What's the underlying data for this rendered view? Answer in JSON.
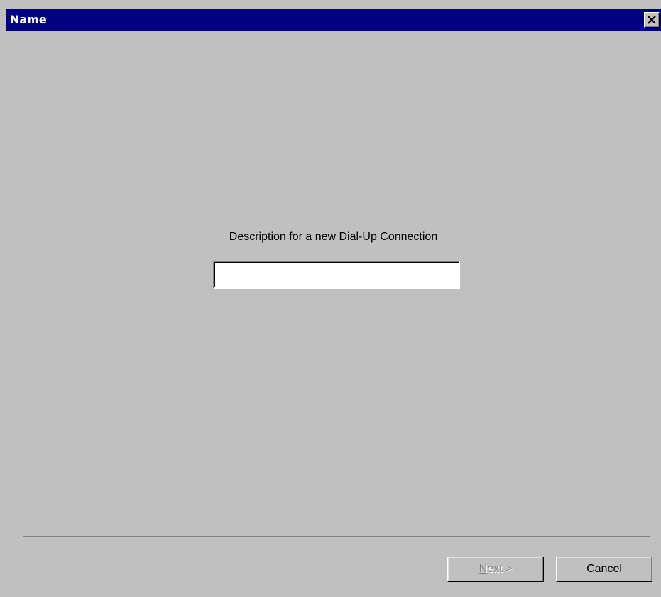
{
  "window": {
    "title": "Name"
  },
  "form": {
    "label_mnemonic": "D",
    "label_rest": "escription for a new Dial-Up Connection",
    "description_value": ""
  },
  "buttons": {
    "next_mnemonic": "N",
    "next_rest": "ext >",
    "next_enabled": "false",
    "cancel_label": "Cancel"
  },
  "icons": {
    "close": "close-icon"
  },
  "colors": {
    "titlebar": "#000080",
    "face": "#c0c0c0",
    "disabled_text": "#808080"
  }
}
